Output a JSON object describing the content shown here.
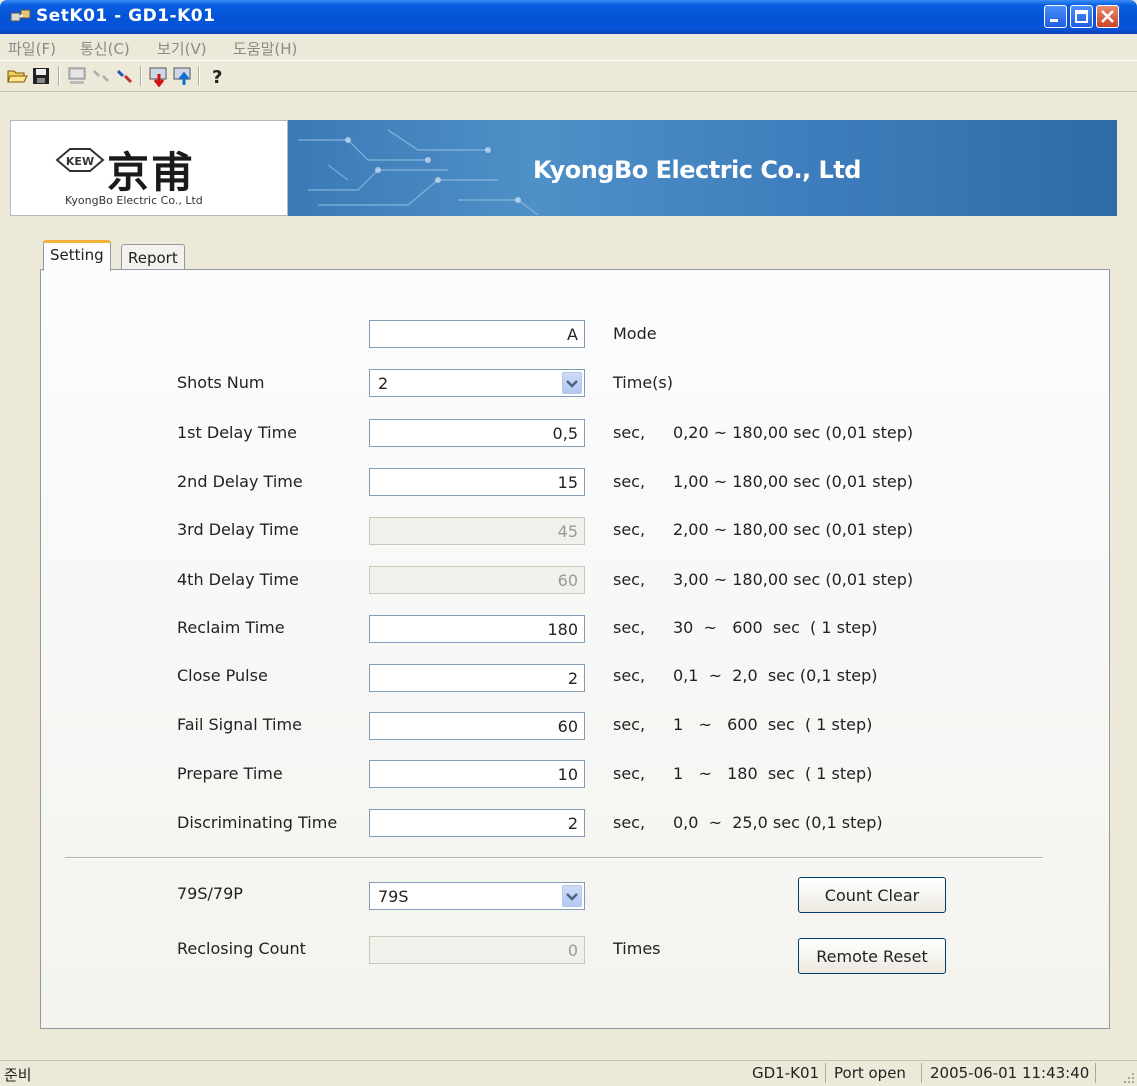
{
  "window": {
    "title": "SetK01 - GD1-K01"
  },
  "menu": [
    "파일(F)",
    "통신(C)",
    "보기(V)",
    "도움말(H)"
  ],
  "banner": {
    "logo_kanji": "京甫",
    "logo_badge": "KEW",
    "logo_subtitle": "KyongBo Electric Co., Ltd",
    "title": "KyongBo Electric Co., Ltd"
  },
  "tabs": [
    "Setting",
    "Report"
  ],
  "form": {
    "mode": {
      "value": "A",
      "suffix": "Mode"
    },
    "shots": {
      "label": "Shots Num",
      "value": "2",
      "suffix": "Time(s)"
    },
    "rows": [
      {
        "label": "1st Delay Time",
        "value": "0,5",
        "unit": "sec,",
        "range": "0,20 ~ 180,00 sec (0,01 step)",
        "disabled": false
      },
      {
        "label": "2nd Delay Time",
        "value": "15",
        "unit": "sec,",
        "range": "1,00 ~ 180,00 sec (0,01 step)",
        "disabled": false
      },
      {
        "label": "3rd Delay Time",
        "value": "45",
        "unit": "sec,",
        "range": "2,00 ~ 180,00 sec (0,01 step)",
        "disabled": true
      },
      {
        "label": "4th Delay Time",
        "value": "60",
        "unit": "sec,",
        "range": "3,00 ~ 180,00 sec (0,01 step)",
        "disabled": true
      },
      {
        "label": "Reclaim Time",
        "value": "180",
        "unit": "sec,",
        "range": "30  ~   600  sec  ( 1 step)",
        "disabled": false
      },
      {
        "label": "Close Pulse",
        "value": "2",
        "unit": "sec,",
        "range": "0,1  ~  2,0  sec (0,1 step)",
        "disabled": false
      },
      {
        "label": "Fail Signal Time",
        "value": "60",
        "unit": "sec,",
        "range": "1   ~   600  sec  ( 1 step)",
        "disabled": false
      },
      {
        "label": "Prepare Time",
        "value": "10",
        "unit": "sec,",
        "range": "1   ~   180  sec  ( 1 step)",
        "disabled": false
      },
      {
        "label": "Discriminating Time",
        "value": "2",
        "unit": "sec,",
        "range": "0,0  ~  25,0 sec (0,1 step)",
        "disabled": false
      }
    ],
    "mode79": {
      "label": "79S/79P",
      "value": "79S"
    },
    "reclosing": {
      "label": "Reclosing Count",
      "value": "0",
      "unit": "Times"
    },
    "buttons": {
      "count_clear": "Count Clear",
      "remote_reset": "Remote Reset"
    }
  },
  "status": {
    "left": "준비",
    "device": "GD1-K01",
    "port": "Port open",
    "datetime": "2005-06-01 11:43:40"
  }
}
